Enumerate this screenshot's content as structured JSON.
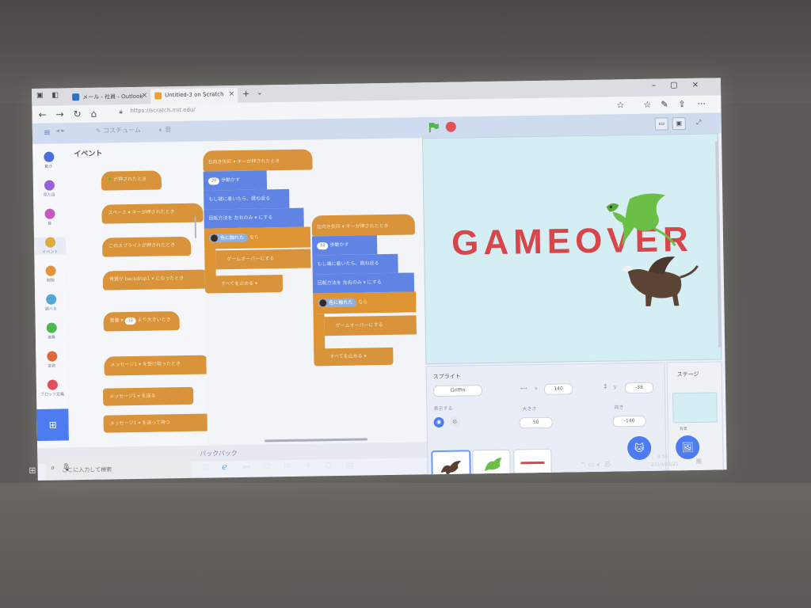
{
  "browser": {
    "tabs": [
      {
        "label": "メール - 社員 - Outlook"
      },
      {
        "label": "Untitled-3 on Scratch"
      }
    ],
    "url": "https://scratch.mit.edu/"
  },
  "scratch": {
    "editor_tabs": {
      "costumes": "コスチューム",
      "sounds": "音"
    },
    "categories": [
      {
        "label": "動き",
        "color": "#4c6fd8"
      },
      {
        "label": "見た目",
        "color": "#9563d6"
      },
      {
        "label": "音",
        "color": "#c457c1"
      },
      {
        "label": "イベント",
        "color": "#e1a83b"
      },
      {
        "label": "制御",
        "color": "#e29237"
      },
      {
        "label": "調べる",
        "color": "#55a7d6"
      },
      {
        "label": "演算",
        "color": "#4cb84d"
      },
      {
        "label": "変数",
        "color": "#e06a36"
      },
      {
        "label": "ブロック定義",
        "color": "#e1505e"
      }
    ],
    "palette": {
      "title": "イベント",
      "blocks": [
        {
          "text": "が押されたとき"
        },
        {
          "text": "スペース ▾ キーが押されたとき"
        },
        {
          "text": "このスプライトが押されたとき"
        },
        {
          "text": "背景が backdrop1 ▾ になったとき"
        },
        {
          "text": "音量 ▾",
          "value": "10",
          "suffix": "より大きいとき"
        },
        {
          "text": "メッセージ1 ▾ を受け取ったとき"
        },
        {
          "text": "メッセージ1 ▾ を送る"
        },
        {
          "text": "メッセージ1 ▾ を送って待つ"
        }
      ]
    },
    "script1": {
      "hat": "右向き矢印 ▾ キーが押されたとき",
      "move": "歩動かす",
      "move_value": "20",
      "bounce": "もし端に着いたら、跳ね返る",
      "rotate": "回転方法を 左右のみ ▾ にする",
      "if_touch": "色に触れた",
      "then_text": "なら",
      "inner": "ゲームオーバーにする",
      "stop": "すべてを止める ▾"
    },
    "script2": {
      "hat": "左向き矢印 ▾ キーが押されたとき",
      "move": "歩動かす",
      "move_value": "10",
      "bounce": "もし端に着いたら、跳ね返る",
      "rotate": "回転方法を 左右のみ ▾ にする",
      "if_touch": "色に触れた",
      "then_text": "なら",
      "inner": "ゲームオーバーにする",
      "stop": "すべてを止める ▾"
    },
    "backpack": "バックパック",
    "stage": {
      "text": "GAMEOVER"
    },
    "sprite_info": {
      "title": "スプライト",
      "name": "Griffin",
      "x_label": "x",
      "x_value": "140",
      "y_label": "y",
      "y_value": "-38",
      "show_label": "表示する",
      "size_label": "大きさ",
      "size_value": "50",
      "direction_label": "向き",
      "direction_value": "-140"
    },
    "stage_panel": {
      "title": "ステージ",
      "backdrop_label": "背景"
    }
  },
  "taskbar": {
    "search_placeholder": "ここに入力して検索",
    "time": "4:51",
    "date": "2019/08/21"
  }
}
